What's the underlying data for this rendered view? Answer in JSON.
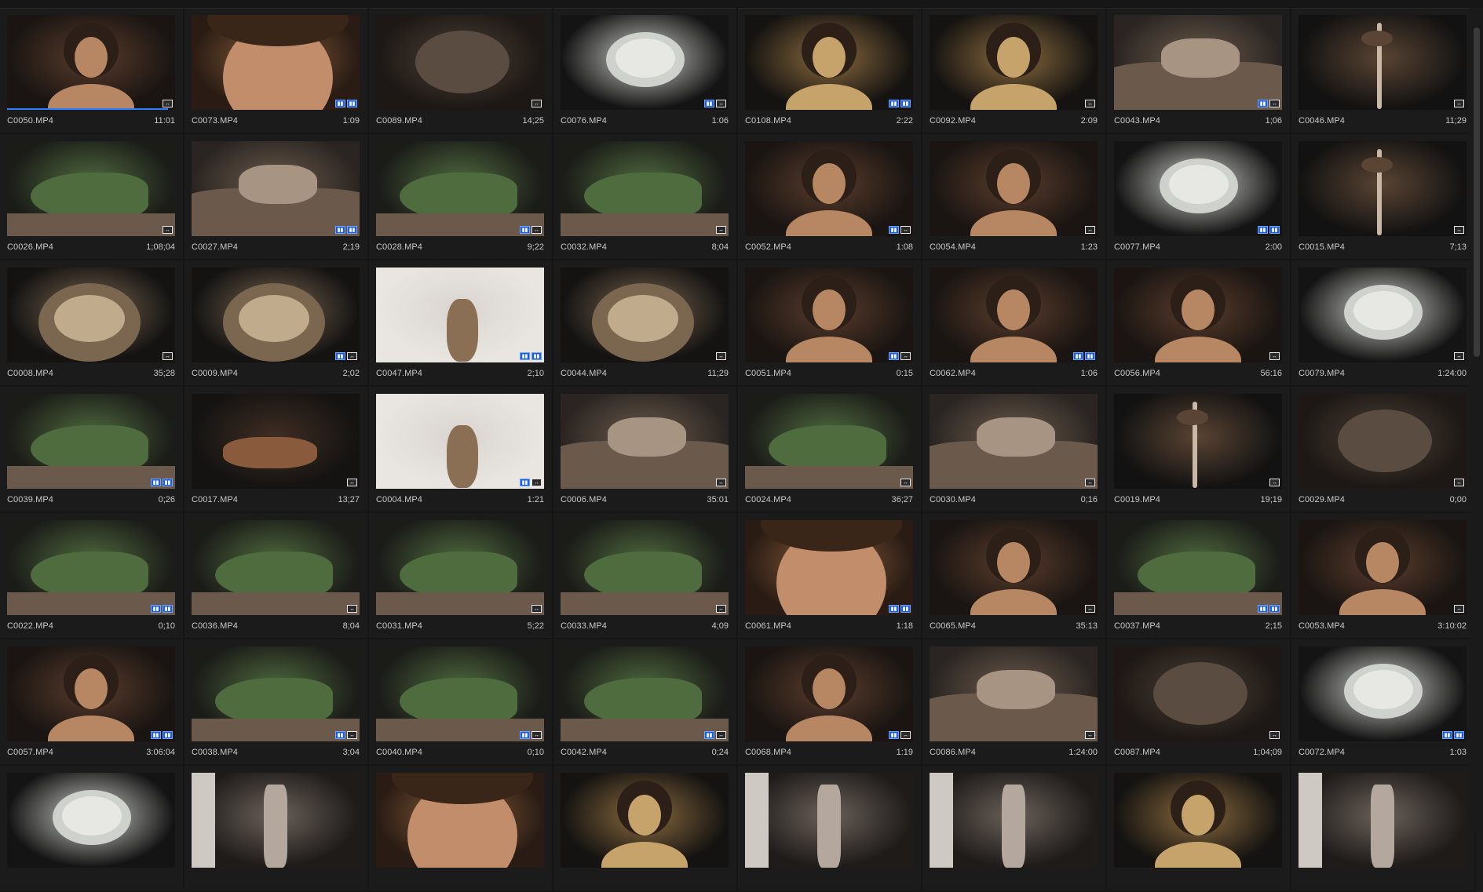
{
  "clips": [
    {
      "name": "C0050.MP4",
      "duration": "11:01",
      "badges": [
        "dark"
      ],
      "theme": "portrait",
      "progress": 0.96
    },
    {
      "name": "C0073.MP4",
      "duration": "1:09",
      "badges": [
        "blue",
        "blue"
      ],
      "theme": "closeup"
    },
    {
      "name": "C0089.MP4",
      "duration": "14;25",
      "badges": [
        "dark"
      ],
      "theme": "blur"
    },
    {
      "name": "C0076.MP4",
      "duration": "1:06",
      "badges": [
        "blue",
        "dark"
      ],
      "theme": "flower"
    },
    {
      "name": "C0108.MP4",
      "duration": "2:22",
      "badges": [
        "blue",
        "blue"
      ],
      "theme": "gold"
    },
    {
      "name": "C0092.MP4",
      "duration": "2:09",
      "badges": [
        "dark"
      ],
      "theme": "gold"
    },
    {
      "name": "C0043.MP4",
      "duration": "1;06",
      "badges": [
        "blue",
        "dark"
      ],
      "theme": "bark"
    },
    {
      "name": "C0046.MP4",
      "duration": "11;29",
      "badges": [
        "dark"
      ],
      "theme": "stem"
    },
    {
      "name": "C0026.MP4",
      "duration": "1;08;04",
      "badges": [
        "dark"
      ],
      "theme": "chameleon"
    },
    {
      "name": "C0027.MP4",
      "duration": "2;19",
      "badges": [
        "blue",
        "blue"
      ],
      "theme": "bark"
    },
    {
      "name": "C0028.MP4",
      "duration": "9;22",
      "badges": [
        "blue",
        "dark"
      ],
      "theme": "chameleon"
    },
    {
      "name": "C0032.MP4",
      "duration": "8;04",
      "badges": [
        "dark"
      ],
      "theme": "chameleon"
    },
    {
      "name": "C0052.MP4",
      "duration": "1:08",
      "badges": [
        "blue",
        "dark"
      ],
      "theme": "portrait"
    },
    {
      "name": "C0054.MP4",
      "duration": "1:23",
      "badges": [
        "dark"
      ],
      "theme": "portrait"
    },
    {
      "name": "C0077.MP4",
      "duration": "2:00",
      "badges": [
        "blue",
        "blue"
      ],
      "theme": "flower"
    },
    {
      "name": "C0015.MP4",
      "duration": "7;13",
      "badges": [
        "dark"
      ],
      "theme": "stem"
    },
    {
      "name": "C0008.MP4",
      "duration": "35;28",
      "badges": [
        "dark"
      ],
      "theme": "dried"
    },
    {
      "name": "C0009.MP4",
      "duration": "2;02",
      "badges": [
        "blue",
        "dark"
      ],
      "theme": "dried"
    },
    {
      "name": "C0047.MP4",
      "duration": "2;10",
      "badges": [
        "blue",
        "blue"
      ],
      "theme": "white"
    },
    {
      "name": "C0044.MP4",
      "duration": "11;29",
      "badges": [
        "dark"
      ],
      "theme": "dried"
    },
    {
      "name": "C0051.MP4",
      "duration": "0:15",
      "badges": [
        "blue",
        "dark"
      ],
      "theme": "portrait"
    },
    {
      "name": "C0062.MP4",
      "duration": "1:06",
      "badges": [
        "blue",
        "blue"
      ],
      "theme": "portrait"
    },
    {
      "name": "C0056.MP4",
      "duration": "56:16",
      "badges": [
        "dark"
      ],
      "theme": "portrait"
    },
    {
      "name": "C0079.MP4",
      "duration": "1:24:00",
      "badges": [
        "dark"
      ],
      "theme": "flower"
    },
    {
      "name": "C0039.MP4",
      "duration": "0;26",
      "badges": [
        "blue",
        "blue"
      ],
      "theme": "chameleon"
    },
    {
      "name": "C0017.MP4",
      "duration": "13;27",
      "badges": [
        "dark"
      ],
      "theme": "hand"
    },
    {
      "name": "C0004.MP4",
      "duration": "1:21",
      "badges": [
        "blue",
        "dark"
      ],
      "theme": "white"
    },
    {
      "name": "C0006.MP4",
      "duration": "35:01",
      "badges": [
        "dark"
      ],
      "theme": "bark"
    },
    {
      "name": "C0024.MP4",
      "duration": "36;27",
      "badges": [
        "dark"
      ],
      "theme": "chameleon"
    },
    {
      "name": "C0030.MP4",
      "duration": "0;16",
      "badges": [
        "dark"
      ],
      "theme": "bark"
    },
    {
      "name": "C0019.MP4",
      "duration": "19;19",
      "badges": [
        "dark"
      ],
      "theme": "stem"
    },
    {
      "name": "C0029.MP4",
      "duration": "0;00",
      "badges": [
        "dark"
      ],
      "theme": "blur"
    },
    {
      "name": "C0022.MP4",
      "duration": "0;10",
      "badges": [
        "blue",
        "blue"
      ],
      "theme": "chameleon"
    },
    {
      "name": "C0036.MP4",
      "duration": "8;04",
      "badges": [
        "dark"
      ],
      "theme": "chameleon"
    },
    {
      "name": "C0031.MP4",
      "duration": "5;22",
      "badges": [
        "dark"
      ],
      "theme": "chameleon"
    },
    {
      "name": "C0033.MP4",
      "duration": "4;09",
      "badges": [
        "dark"
      ],
      "theme": "chameleon"
    },
    {
      "name": "C0061.MP4",
      "duration": "1:18",
      "badges": [
        "blue",
        "blue"
      ],
      "theme": "closeup"
    },
    {
      "name": "C0065.MP4",
      "duration": "35:13",
      "badges": [
        "dark"
      ],
      "theme": "portrait"
    },
    {
      "name": "C0037.MP4",
      "duration": "2;15",
      "badges": [
        "blue",
        "blue"
      ],
      "theme": "chameleon"
    },
    {
      "name": "C0053.MP4",
      "duration": "3:10:02",
      "badges": [
        "dark"
      ],
      "theme": "portrait"
    },
    {
      "name": "C0057.MP4",
      "duration": "3:06:04",
      "badges": [
        "blue",
        "blue"
      ],
      "theme": "portrait"
    },
    {
      "name": "C0038.MP4",
      "duration": "3;04",
      "badges": [
        "blue",
        "dark"
      ],
      "theme": "chameleon"
    },
    {
      "name": "C0040.MP4",
      "duration": "0;10",
      "badges": [
        "blue",
        "dark"
      ],
      "theme": "chameleon"
    },
    {
      "name": "C0042.MP4",
      "duration": "0;24",
      "badges": [
        "blue",
        "dark"
      ],
      "theme": "chameleon"
    },
    {
      "name": "C0068.MP4",
      "duration": "1:19",
      "badges": [
        "blue",
        "dark"
      ],
      "theme": "portrait"
    },
    {
      "name": "C0086.MP4",
      "duration": "1:24:00",
      "badges": [
        "dark"
      ],
      "theme": "bark"
    },
    {
      "name": "C0087.MP4",
      "duration": "1;04;09",
      "badges": [
        "dark"
      ],
      "theme": "blur"
    },
    {
      "name": "C0072.MP4",
      "duration": "1:03",
      "badges": [
        "blue",
        "blue"
      ],
      "theme": "flower"
    },
    {
      "name": "",
      "duration": "",
      "badges": [],
      "theme": "flower"
    },
    {
      "name": "",
      "duration": "",
      "badges": [],
      "theme": "studio"
    },
    {
      "name": "",
      "duration": "",
      "badges": [],
      "theme": "closeup"
    },
    {
      "name": "",
      "duration": "",
      "badges": [],
      "theme": "gold"
    },
    {
      "name": "",
      "duration": "",
      "badges": [],
      "theme": "studio"
    },
    {
      "name": "",
      "duration": "",
      "badges": [],
      "theme": "studio"
    },
    {
      "name": "",
      "duration": "",
      "badges": [],
      "theme": "gold"
    },
    {
      "name": "",
      "duration": "",
      "badges": [],
      "theme": "studio"
    }
  ],
  "theme_colors": {
    "portrait": [
      "#1a1512",
      "#5a3c2c",
      "#b78663"
    ],
    "closeup": [
      "#2a1c14",
      "#8b5e3c",
      "#c28d6b"
    ],
    "blur": [
      "#1d1815",
      "#4b3e34",
      "#5b4c41"
    ],
    "flower": [
      "#141414",
      "#cfd1cd",
      "#8b8f84"
    ],
    "gold": [
      "#151311",
      "#8a6a3e",
      "#c6a36b"
    ],
    "bark": [
      "#2a2522",
      "#6b5a4b",
      "#a89483"
    ],
    "stem": [
      "#121212",
      "#5a4433",
      "#c9b8a5"
    ],
    "chameleon": [
      "#1b1b18",
      "#4f6c3f",
      "#7e9a6f"
    ],
    "dried": [
      "#141312",
      "#7b6650",
      "#c1ab8d"
    ],
    "white": [
      "#e9e6e1",
      "#d9d4cf",
      "#8a6f55"
    ],
    "hand": [
      "#141312",
      "#3f2d22",
      "#8a5a3d"
    ],
    "studio": [
      "#1e1b19",
      "#6a6059",
      "#b3a79e"
    ]
  },
  "scrollbar": {
    "position": 0.02,
    "visible_fraction": 0.4
  }
}
